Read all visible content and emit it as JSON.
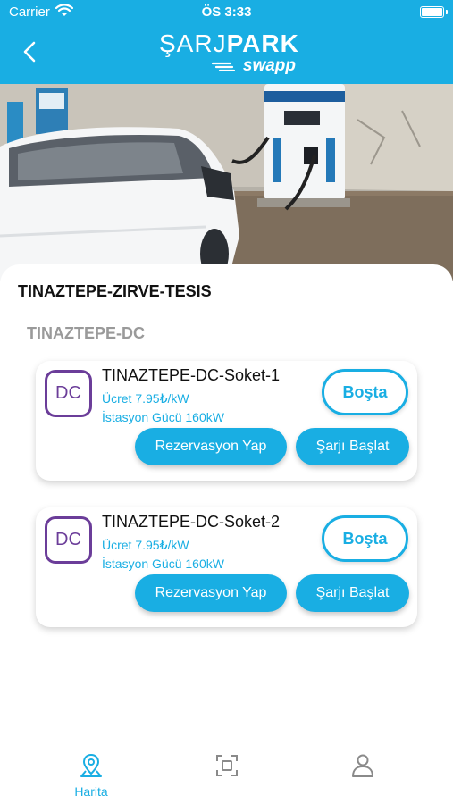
{
  "status_bar": {
    "carrier": "Carrier",
    "time": "ÖS 3:33"
  },
  "header": {
    "logo_main_light": "ŞARJ",
    "logo_main_bold": "PARK",
    "logo_sub": "swapp",
    "back_icon": "chevron-left-icon"
  },
  "station": {
    "title": "TINAZTEPE-ZIRVE-TESIS",
    "group": "TINAZTEPE-DC",
    "sockets": [
      {
        "type": "DC",
        "name": "TINAZTEPE-DC-Soket-1",
        "price": "Ücret 7.95₺/kW",
        "power": "İstasyon Gücü 160kW",
        "state": "Boşta",
        "reserve_label": "Rezervasyon Yap",
        "charge_label": "Şarjı Başlat"
      },
      {
        "type": "DC",
        "name": "TINAZTEPE-DC-Soket-2",
        "price": "Ücret 7.95₺/kW",
        "power": "İstasyon Gücü 160kW",
        "state": "Boşta",
        "reserve_label": "Rezervasyon Yap",
        "charge_label": "Şarjı Başlat"
      }
    ]
  },
  "tabbar": {
    "tabs": [
      {
        "label": "Harita",
        "icon": "map-pin-icon",
        "active": true
      },
      {
        "label": "",
        "icon": "scan-icon",
        "active": false
      },
      {
        "label": "",
        "icon": "user-icon",
        "active": false
      }
    ]
  },
  "colors": {
    "accent": "#19aee3",
    "dc_badge": "#6b3d99"
  }
}
